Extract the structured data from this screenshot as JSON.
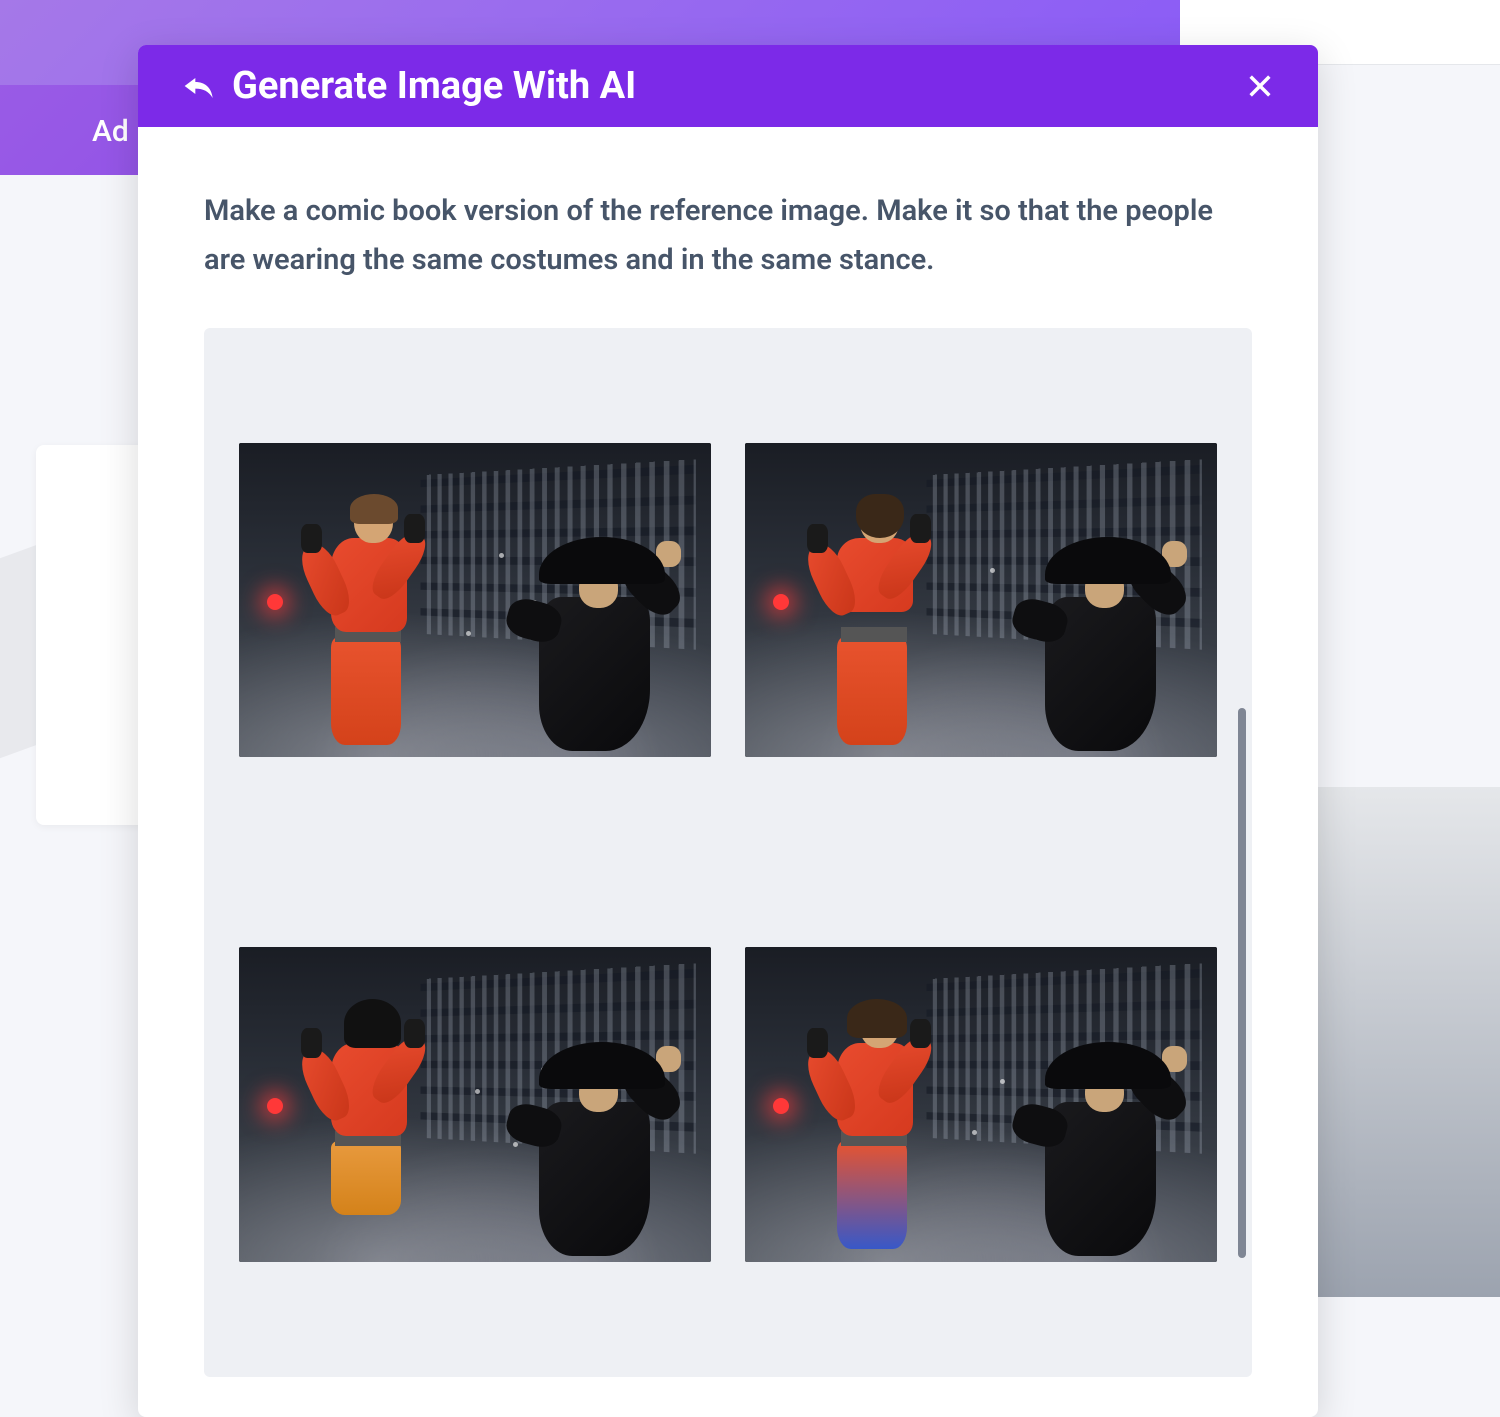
{
  "background": {
    "nav_text": "Ad"
  },
  "modal": {
    "title": "Generate Image With AI",
    "prompt": "Make a comic book version of the reference image. Make it so that the people are wearing the same costumes and in the same stance.",
    "results": {
      "items": [
        {
          "variant": "v1"
        },
        {
          "variant": "v2"
        },
        {
          "variant": "v3"
        },
        {
          "variant": "v4"
        }
      ]
    }
  },
  "icons": {
    "back": "reply-icon",
    "close": "close-icon"
  },
  "colors": {
    "header_bg": "#7c2ae8",
    "panel_bg": "#eef0f4",
    "text": "#475569"
  }
}
